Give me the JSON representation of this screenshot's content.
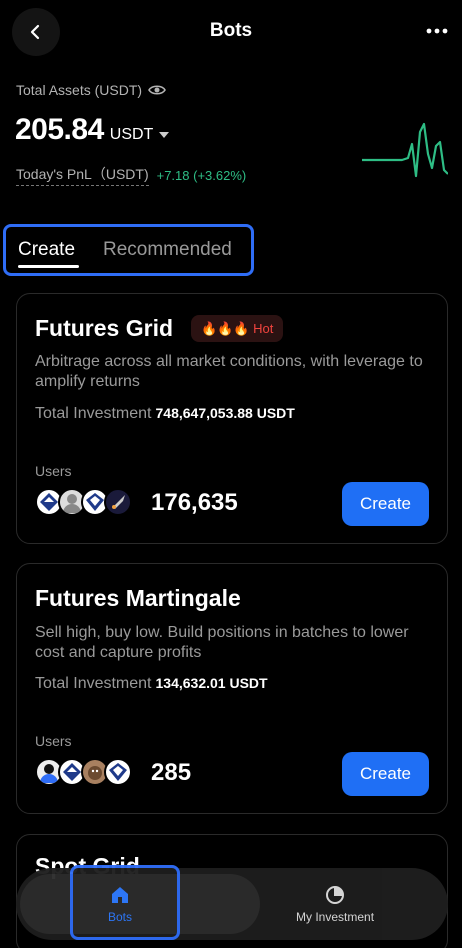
{
  "header": {
    "title": "Bots"
  },
  "assets": {
    "label": "Total Assets (USDT)",
    "value": "205.84",
    "unit": "USDT",
    "pnl_label": "Today's PnL（USDT)",
    "pnl_value": "+7.18 (+3.62%)",
    "pnl_color": "#2ebd85"
  },
  "tabs": [
    {
      "label": "Create",
      "active": true
    },
    {
      "label": "Recommended",
      "active": false
    }
  ],
  "cards": [
    {
      "title": "Futures Grid",
      "badge": "🔥🔥🔥 Hot",
      "description": "Arbitrage across all market conditions, with leverage to amplify returns",
      "investment_label": "Total Investment",
      "investment_value": "748,647,053.88 USDT",
      "users_label": "Users",
      "users_count": "176,635",
      "button": "Create"
    },
    {
      "title": "Futures Martingale",
      "description": "Sell high, buy low. Build positions in batches to lower cost and capture profits",
      "investment_label": "Total Investment",
      "investment_value": "134,632.01 USDT",
      "users_label": "Users",
      "users_count": "285",
      "button": "Create"
    },
    {
      "title": "Spot Grid"
    }
  ],
  "bottom_nav": [
    {
      "label": "Bots",
      "icon": "home-icon",
      "active": true
    },
    {
      "label": "My Investment",
      "icon": "pie-chart-icon",
      "active": false
    }
  ],
  "colors": {
    "accent": "#1f6ff5",
    "positive": "#2ebd85",
    "hot": "#f0443e"
  }
}
